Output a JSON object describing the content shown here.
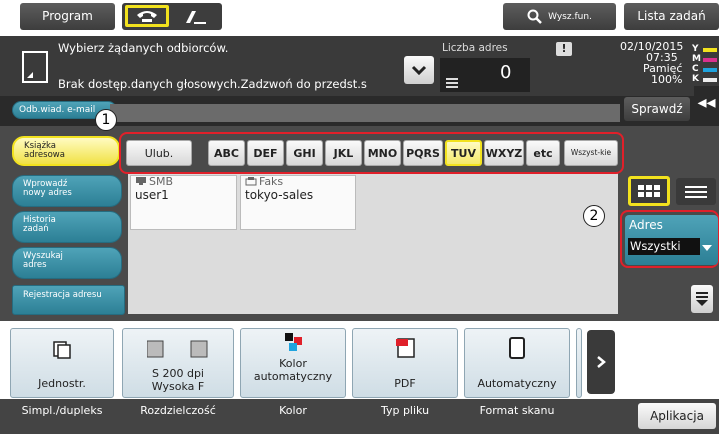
{
  "top": {
    "program": "Program",
    "search": "Wysz.fun.",
    "lista": "Lista zadań"
  },
  "status": {
    "line1": "Wybierz żądanych odbiorców.",
    "line2": "Brak dostęp.danych głosowych.Zadzwoń do przedst.s",
    "liczba_label": "Liczba adres",
    "liczba_value": "0",
    "date": "02/10/2015",
    "time": "07:35",
    "pamiec_label": "Pamięć",
    "pamiec_value": "100%",
    "toner": [
      "Y",
      "M",
      "C",
      "K"
    ]
  },
  "email_btn": "Odb.wiad. e-mail",
  "sprawdz": "Sprawdź",
  "sidebar": [
    {
      "label": "Książka adresowa"
    },
    {
      "label": "Wprowadź nowy adres"
    },
    {
      "label": "Historia zadań"
    },
    {
      "label": "Wyszukaj adres"
    },
    {
      "label": "Rejestracja adresu"
    }
  ],
  "index_tabs": [
    "Ulub.",
    "ABC",
    "DEF",
    "GHI",
    "JKL",
    "MNO",
    "PQRS",
    "TUV",
    "WXYZ",
    "etc",
    "Wszyst-kie"
  ],
  "selected_tab": "TUV",
  "addresses": [
    {
      "type": "SMB",
      "name": "user1"
    },
    {
      "type": "Faks",
      "name": "tokyo-sales"
    }
  ],
  "annotations": [
    "1",
    "2"
  ],
  "adres_filter": {
    "label": "Adres",
    "value": "Wszystki"
  },
  "settings": [
    {
      "value": "Jednostr.",
      "caption": "Simpl./dupleks"
    },
    {
      "value": "S 200 dpi\nWysoka F",
      "caption": "Rozdzielczość"
    },
    {
      "value": "Kolor automatyczny",
      "caption": "Kolor"
    },
    {
      "value": "PDF",
      "caption": "Typ pliku"
    },
    {
      "value": "Automatyczny",
      "caption": "Format skanu"
    }
  ],
  "aplikacja": "Aplikacja",
  "colors": {
    "accent_yellow": "#f2e21e",
    "teal": "#2c7f95",
    "red": "#e0202a"
  }
}
